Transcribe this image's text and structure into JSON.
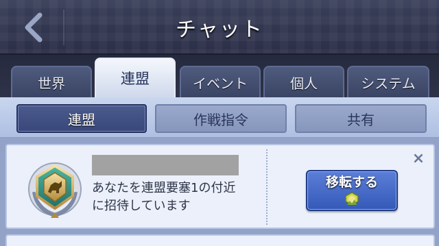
{
  "header": {
    "title": "チャット"
  },
  "tabs": [
    {
      "label": "世界",
      "active": false
    },
    {
      "label": "連盟",
      "active": true
    },
    {
      "label": "イベント",
      "active": false
    },
    {
      "label": "個人",
      "active": false
    },
    {
      "label": "システム",
      "active": false
    }
  ],
  "subtabs": [
    {
      "label": "連盟",
      "active": true
    },
    {
      "label": "作戦指令",
      "active": false
    },
    {
      "label": "共有",
      "active": false
    }
  ],
  "message_card": {
    "sender_name": "",
    "text_line1": "あなたを連盟要塞1の付近",
    "text_line2": "に招待しています",
    "move_button_label": "移転する",
    "close_symbol": "×"
  },
  "colors": {
    "header_bg": "#2b2f47",
    "active_tab": "#f4f7fc",
    "move_button": "#3559b8",
    "card_bg": "#ebf0fb"
  },
  "icons": {
    "back": "chevron-left-icon",
    "badge": "alliance-badge-icon",
    "move": "relocate-icon",
    "close": "close-icon"
  }
}
